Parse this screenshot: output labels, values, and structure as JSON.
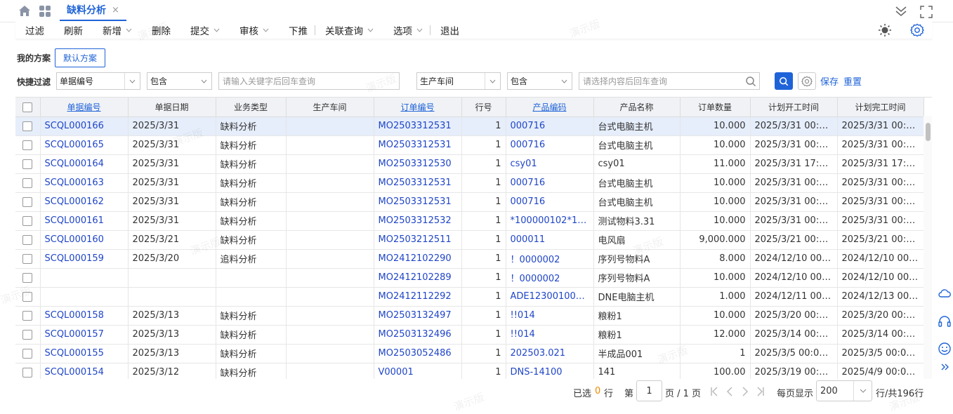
{
  "tab": {
    "title": "缺料分析",
    "close": "×"
  },
  "toolbar": {
    "filter": "过滤",
    "refresh": "刷新",
    "new": "新增",
    "delete": "删除",
    "submit": "提交",
    "audit": "审核",
    "push_down": "下推",
    "related_query": "关联查询",
    "options": "选项",
    "exit": "退出"
  },
  "scheme": {
    "label": "我的方案",
    "default": "默认方案"
  },
  "quick_filter": {
    "label": "快捷过滤",
    "field1": "单据编号",
    "op1": "包含",
    "input1_placeholder": "请输入关键字后回车查询",
    "field2": "生产车间",
    "op2": "包含",
    "input2_placeholder": "请选择内容后回车查询",
    "save": "保存",
    "reset": "重置"
  },
  "columns": [
    "单据编号",
    "单据日期",
    "业务类型",
    "生产车间",
    "订单编号",
    "行号",
    "产品编码",
    "产品名称",
    "订单数量",
    "计划开工时间",
    "计划完工时间"
  ],
  "rows": [
    [
      "SCQL000166",
      "2025/3/31",
      "缺料分析",
      "",
      "MO2503312531",
      "1",
      "000716",
      "台式电脑主机",
      "10.000",
      "2025/3/31 00:00...",
      "2025/3/31 00:00..."
    ],
    [
      "SCQL000165",
      "2025/3/31",
      "缺料分析",
      "",
      "MO2503312531",
      "1",
      "000716",
      "台式电脑主机",
      "10.000",
      "2025/3/31 00:00...",
      "2025/3/31 00:00..."
    ],
    [
      "SCQL000164",
      "2025/3/31",
      "缺料分析",
      "",
      "MO2503312530",
      "1",
      "csy01",
      "csy01",
      "11.000",
      "2025/3/31 17:30...",
      "2025/3/31 17:30..."
    ],
    [
      "SCQL000163",
      "2025/3/31",
      "缺料分析",
      "",
      "MO2503312531",
      "1",
      "000716",
      "台式电脑主机",
      "10.000",
      "2025/3/31 00:00...",
      "2025/3/31 00:00..."
    ],
    [
      "SCQL000162",
      "2025/3/31",
      "缺料分析",
      "",
      "MO2503312531",
      "1",
      "000716",
      "台式电脑主机",
      "10.000",
      "2025/3/31 00:00...",
      "2025/3/31 00:00..."
    ],
    [
      "SCQL000161",
      "2025/3/31",
      "缺料分析",
      "",
      "MO2503312532",
      "1",
      "*100000102*1000",
      "测试物料3.31",
      "10.000",
      "2025/3/31 00:00...",
      "2025/3/31 00:00..."
    ],
    [
      "SCQL000160",
      "2025/3/21",
      "缺料分析",
      "",
      "MO2503212511",
      "1",
      "000011",
      "电风扇",
      "9,000.000",
      "2025/3/21 00:00...",
      "2025/3/21 00:00..."
    ],
    [
      "SCQL000159",
      "2025/3/20",
      "追料分析",
      "",
      "MO2412102290",
      "1",
      "！0000002",
      "序列号物料A",
      "8.000",
      "2024/12/10 00:0...",
      "2024/12/10 00:0..."
    ],
    [
      "",
      "",
      "",
      "",
      "MO2412102289",
      "1",
      "！0000002",
      "序列号物料A",
      "10.000",
      "2024/12/10 00:0...",
      "2024/12/10 00:0..."
    ],
    [
      "",
      "",
      "",
      "",
      "MO2412112292",
      "1",
      "ADE123001000001",
      "DNE电脑主机",
      "1.000",
      "2024/12/11 00:0...",
      "2024/12/13 00:0..."
    ],
    [
      "SCQL000158",
      "2025/3/13",
      "缺料分析",
      "",
      "MO2503132497",
      "1",
      "!!014",
      "粮粉1",
      "10.000",
      "2025/3/20 00:00...",
      "2025/3/20 00:00..."
    ],
    [
      "SCQL000157",
      "2025/3/13",
      "缺料分析",
      "",
      "MO2503132496",
      "1",
      "!!014",
      "粮粉1",
      "12.000",
      "2025/3/14 00:00...",
      "2025/3/14 00:00..."
    ],
    [
      "SCQL000155",
      "2025/3/13",
      "缺料分析",
      "",
      "MO2503052486",
      "1",
      "202503.021",
      "半成品001",
      "1",
      "2025/3/5 00:00:00",
      "2025/3/5 00:00:00"
    ],
    [
      "SCQL000154",
      "2025/3/12",
      "缺料分析",
      "",
      "V00001",
      "1",
      "DNS-14100",
      "141",
      "100.00",
      "2025/3/19 00:00...",
      "2025/4/9 00:00:00"
    ]
  ],
  "pager": {
    "selected_prefix": "已选",
    "selected_count": "0",
    "selected_suffix": "行",
    "page_prefix": "第",
    "page": "1",
    "page_suffix": "页 / 1 页",
    "per_page_label": "每页显示",
    "per_page": "200",
    "total": "行/共196行"
  },
  "watermark": "演示版",
  "colors": {
    "accent": "#1f63d8",
    "link": "#1f45c8",
    "selected_row": "#e6eefb",
    "count": "#f08a00"
  }
}
